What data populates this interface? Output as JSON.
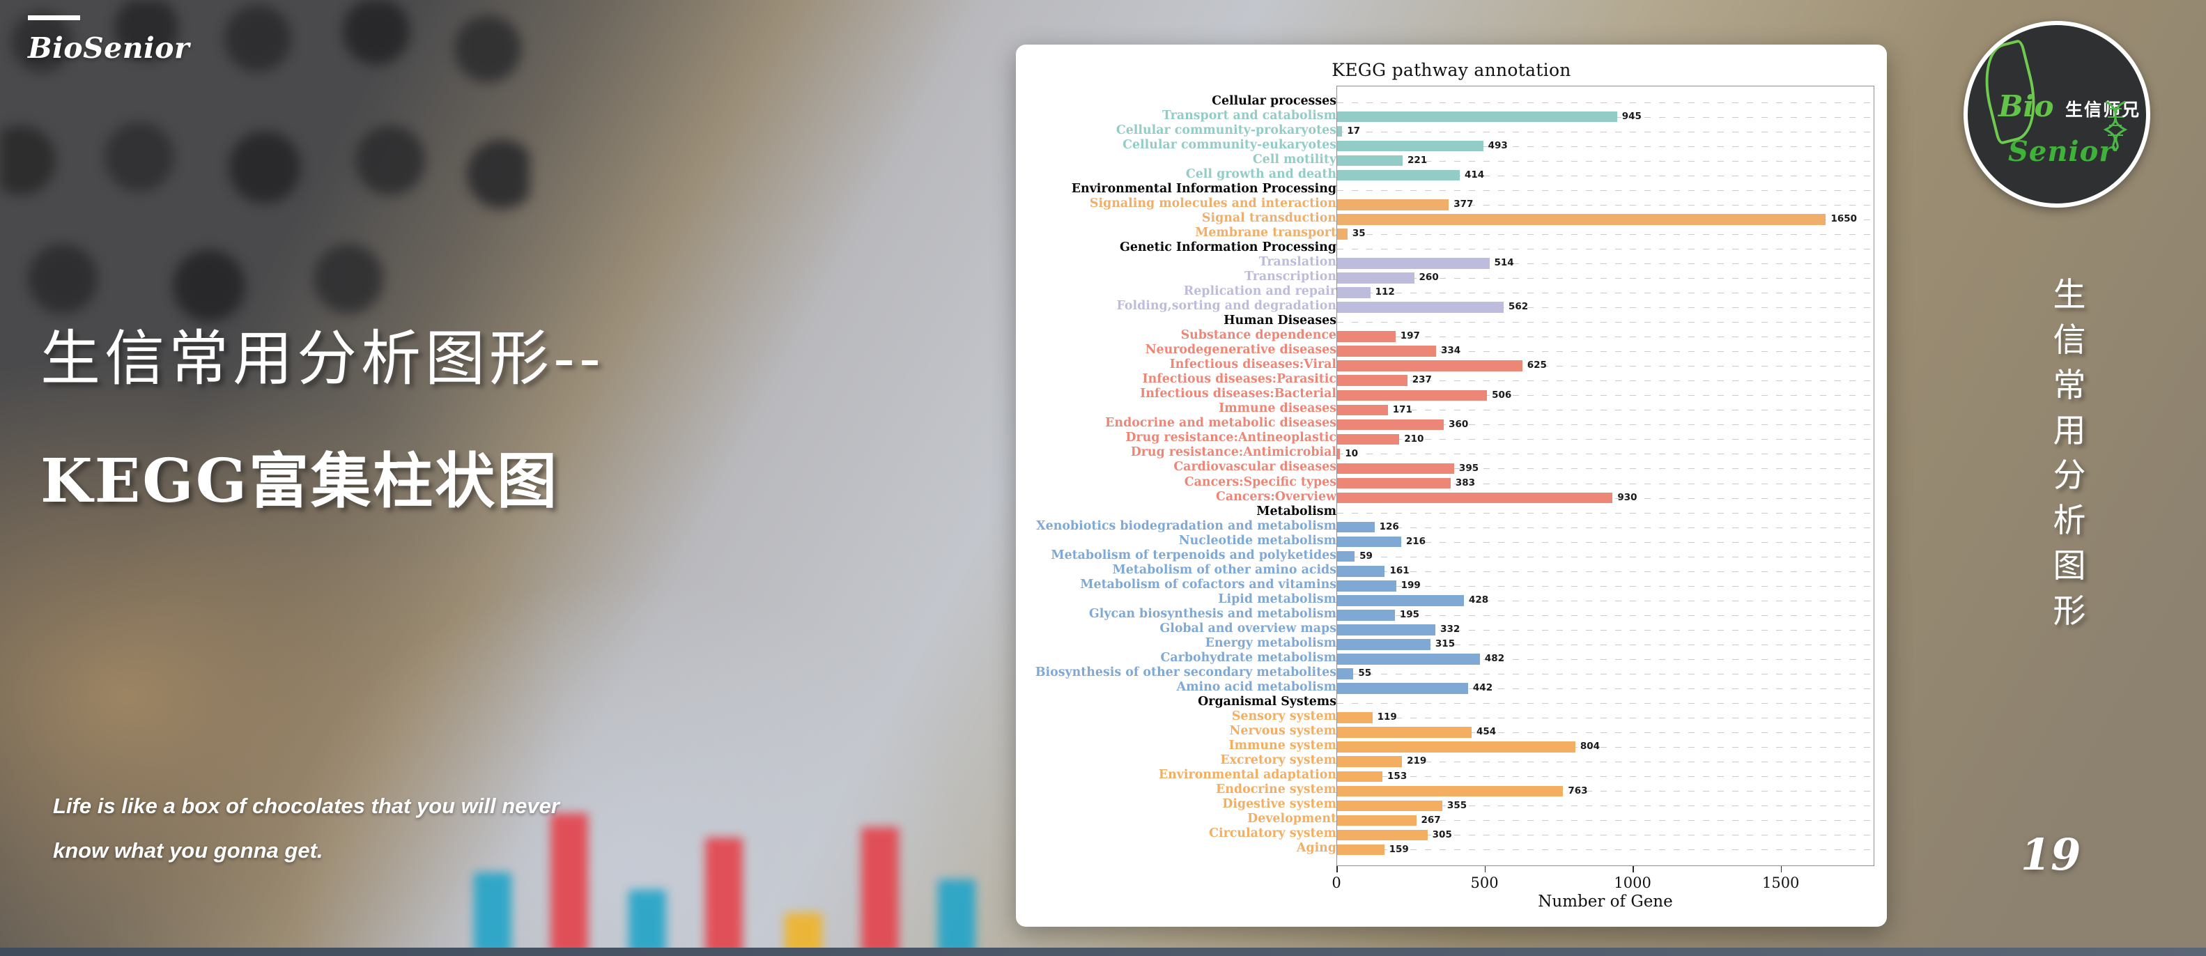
{
  "brand": {
    "name": "BioSenior"
  },
  "headline": {
    "line1": "生信常用分析图形--",
    "line2": "KEGG富集柱状图"
  },
  "quote": {
    "text": "Life is like a box of chocolates that you will never know what you gonna get."
  },
  "right_rail": {
    "logo": {
      "bio": "Bio",
      "chinese": "生信师兄",
      "senior": "Senior"
    },
    "vertical_title": "生信常用分析图形",
    "page_number": "19"
  },
  "chart_data": {
    "type": "bar",
    "orientation": "horizontal",
    "title": "KEGG pathway annotation",
    "xlabel": "Number of Gene",
    "ylabel": "",
    "xlim": [
      0,
      1750
    ],
    "xticks": [
      0,
      500,
      1000,
      1500
    ],
    "xtick_labels": [
      "0",
      "500",
      "1000",
      "1500"
    ],
    "grid": true,
    "legend": "none",
    "groups": [
      {
        "name": "Cellular processes",
        "color": "#93ccc6",
        "categories": [
          "Transport and catabolism",
          "Cellular community-prokaryotes",
          "Cellular community-eukaryotes",
          "Cell motility",
          "Cell growth and death"
        ],
        "values": [
          945,
          17,
          493,
          221,
          414
        ]
      },
      {
        "name": "Environmental Information Processing",
        "color": "#f0ae6b",
        "categories": [
          "Signaling molecules and interaction",
          "Signal transduction",
          "Membrane transport"
        ],
        "values": [
          377,
          1650,
          35
        ]
      },
      {
        "name": "Genetic Information Processing",
        "color": "#bdbcdc",
        "categories": [
          "Translation",
          "Transcription",
          "Replication and repair",
          "Folding,sorting and degradation"
        ],
        "values": [
          514,
          260,
          112,
          562
        ]
      },
      {
        "name": "Human Diseases",
        "color": "#ec8777",
        "categories": [
          "Substance dependence",
          "Neurodegenerative diseases",
          "Infectious diseases:Viral",
          "Infectious diseases:Parasitic",
          "Infectious diseases:Bacterial",
          "Immune diseases",
          "Endocrine and metabolic diseases",
          "Drug resistance:Antineoplastic",
          "Drug resistance:Antimicrobial",
          "Cardiovascular diseases",
          "Cancers:Specific types",
          "Cancers:Overview"
        ],
        "values": [
          197,
          334,
          625,
          237,
          506,
          171,
          360,
          210,
          10,
          395,
          383,
          930
        ]
      },
      {
        "name": "Metabolism",
        "color": "#7fa9d4",
        "categories": [
          "Xenobiotics biodegradation and metabolism",
          "Nucleotide metabolism",
          "Metabolism of terpenoids and polyketides",
          "Metabolism of other amino acids",
          "Metabolism of cofactors and vitamins",
          "Lipid metabolism",
          "Glycan biosynthesis and metabolism",
          "Global and overview maps",
          "Energy metabolism",
          "Carbohydrate metabolism",
          "Biosynthesis of other secondary metabolites",
          "Amino acid metabolism"
        ],
        "values": [
          126,
          216,
          59,
          161,
          199,
          428,
          195,
          332,
          315,
          482,
          55,
          442
        ]
      },
      {
        "name": "Organismal Systems",
        "color": "#f3ae62",
        "categories": [
          "Sensory system",
          "Nervous system",
          "Immune system",
          "Excretory system",
          "Environmental adaptation",
          "Endocrine system",
          "Digestive system",
          "Development",
          "Circulatory system",
          "Aging"
        ],
        "values": [
          119,
          454,
          804,
          219,
          153,
          763,
          355,
          267,
          305,
          159
        ]
      }
    ]
  }
}
